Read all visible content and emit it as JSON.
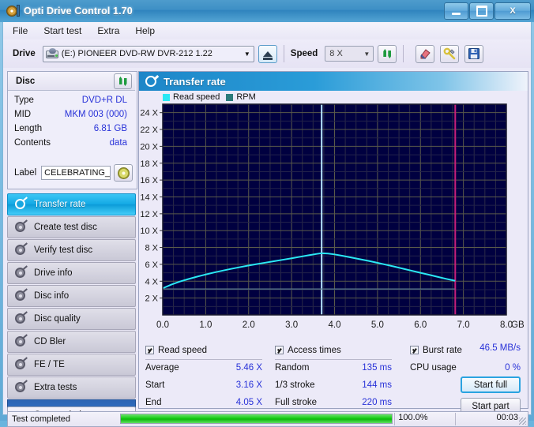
{
  "window": {
    "title": "Opti Drive Control 1.70",
    "icon": "disc-drive-icon",
    "minimize": "–",
    "maximize": "□",
    "close": "X"
  },
  "menu": {
    "items": [
      {
        "label": "File"
      },
      {
        "label": "Start test"
      },
      {
        "label": "Extra"
      },
      {
        "label": "Help"
      }
    ]
  },
  "toolbar": {
    "drive_label": "Drive",
    "drive_value": "(E:)   PIONEER DVD-RW  DVR-212 1.22",
    "drive_arrow": "▼",
    "eject_icon": "eject-icon",
    "speed_label": "Speed",
    "speed_value": "8 X",
    "speed_arrow": "▼",
    "refresh_icon": "refresh-icon",
    "eraser_icon": "eraser-icon",
    "tools_icon": "tools-icon",
    "save_icon": "save-icon"
  },
  "disc_panel": {
    "title": "Disc",
    "refresh_icon": "refresh-icon",
    "rows": [
      {
        "key": "Type",
        "value": "DVD+R DL"
      },
      {
        "key": "MID",
        "value": "MKM 003 (000)"
      },
      {
        "key": "Length",
        "value": "6.81 GB"
      },
      {
        "key": "Contents",
        "value": "data"
      }
    ],
    "label_key": "Label",
    "label_value": "CELEBRATING_",
    "disc_icon": "disc-icon"
  },
  "nav": {
    "items": [
      {
        "label": "Transfer rate",
        "selected": true
      },
      {
        "label": "Create test disc",
        "selected": false
      },
      {
        "label": "Verify test disc",
        "selected": false
      },
      {
        "label": "Drive info",
        "selected": false
      },
      {
        "label": "Disc info",
        "selected": false
      },
      {
        "label": "Disc quality",
        "selected": false
      },
      {
        "label": "CD Bler",
        "selected": false
      },
      {
        "label": "FE / TE",
        "selected": false
      },
      {
        "label": "Extra tests",
        "selected": false
      }
    ],
    "status_window_button": "Status window > >"
  },
  "chart_panel": {
    "title": "Transfer rate",
    "icon": "speedometer-icon"
  },
  "chart_data": {
    "type": "line",
    "title": "Transfer rate",
    "xlabel": "GB",
    "ylabel": "X",
    "xlim": [
      0.0,
      8.0
    ],
    "ylim": [
      0.0,
      25.0
    ],
    "grid": true,
    "legend_position": "top-left",
    "x_ticks": [
      "0.0",
      "1.0",
      "2.0",
      "3.0",
      "4.0",
      "5.0",
      "6.0",
      "7.0",
      "8.0"
    ],
    "x_tick_values": [
      0,
      1,
      2,
      3,
      4,
      5,
      6,
      7,
      8
    ],
    "x_axis_unit": "GB",
    "y_ticks": [
      "2 X",
      "4 X",
      "6 X",
      "8 X",
      "10 X",
      "12 X",
      "14 X",
      "16 X",
      "18 X",
      "20 X",
      "22 X",
      "24 X"
    ],
    "y_tick_values": [
      2,
      4,
      6,
      8,
      10,
      12,
      14,
      16,
      18,
      20,
      22,
      24
    ],
    "legend": [
      {
        "name": "Read speed",
        "color": "#2ae8f4"
      },
      {
        "name": "RPM",
        "color": "#2b7b7b"
      }
    ],
    "series": [
      {
        "name": "Read speed",
        "color": "#2ae8f4",
        "x": [
          0.0,
          0.2,
          0.4,
          0.6,
          0.8,
          1.0,
          1.2,
          1.4,
          1.6,
          1.8,
          2.0,
          2.2,
          2.4,
          2.6,
          2.8,
          3.0,
          3.2,
          3.4,
          3.6,
          3.7,
          3.85,
          4.0,
          4.2,
          4.4,
          4.6,
          4.8,
          5.0,
          5.2,
          5.4,
          5.6,
          5.8,
          6.0,
          6.2,
          6.4,
          6.6,
          6.81
        ],
        "y": [
          3.16,
          3.6,
          3.96,
          4.26,
          4.54,
          4.8,
          5.04,
          5.26,
          5.47,
          5.67,
          5.86,
          6.04,
          6.21,
          6.38,
          6.55,
          6.72,
          6.9,
          7.08,
          7.25,
          7.32,
          7.28,
          7.18,
          7.0,
          6.8,
          6.6,
          6.4,
          6.18,
          5.95,
          5.72,
          5.48,
          5.24,
          5.0,
          4.76,
          4.52,
          4.28,
          4.05
        ]
      },
      {
        "name": "RPM",
        "color": "#5f7f8f",
        "x": [
          0.0,
          6.81
        ],
        "y": [
          3.08,
          3.08
        ]
      }
    ],
    "markers": [
      {
        "name": "layer-break-marker",
        "x": 3.7,
        "color": "#b8e6ff"
      },
      {
        "name": "disc-end-marker",
        "x": 6.81,
        "color": "#c61f7a"
      }
    ]
  },
  "stats": {
    "read_speed": {
      "checked": true,
      "title": "Read speed",
      "rows": [
        {
          "key": "Average",
          "value": "5.46 X"
        },
        {
          "key": "Start",
          "value": "3.16 X"
        },
        {
          "key": "End",
          "value": "4.05 X"
        }
      ]
    },
    "access_times": {
      "checked": true,
      "title": "Access times",
      "rows": [
        {
          "key": "Random",
          "value": "135 ms"
        },
        {
          "key": "1/3 stroke",
          "value": "144 ms"
        },
        {
          "key": "Full stroke",
          "value": "220 ms"
        }
      ]
    },
    "burst": {
      "checked": true,
      "title": "Burst rate",
      "burst_value": "46.5 MB/s",
      "cpu_key": "CPU usage",
      "cpu_value": "0 %",
      "start_full": "Start full",
      "start_part": "Start part"
    }
  },
  "statusbar": {
    "message": "Test completed",
    "progress_percent": "100.0%",
    "progress_value": 100,
    "elapsed": "00:03"
  },
  "colors": {
    "accent": "#12a8e4",
    "value_text": "#2832d8",
    "plot_bg": "#000040",
    "read_speed": "#2ae8f4",
    "progress": "#17cc17"
  }
}
